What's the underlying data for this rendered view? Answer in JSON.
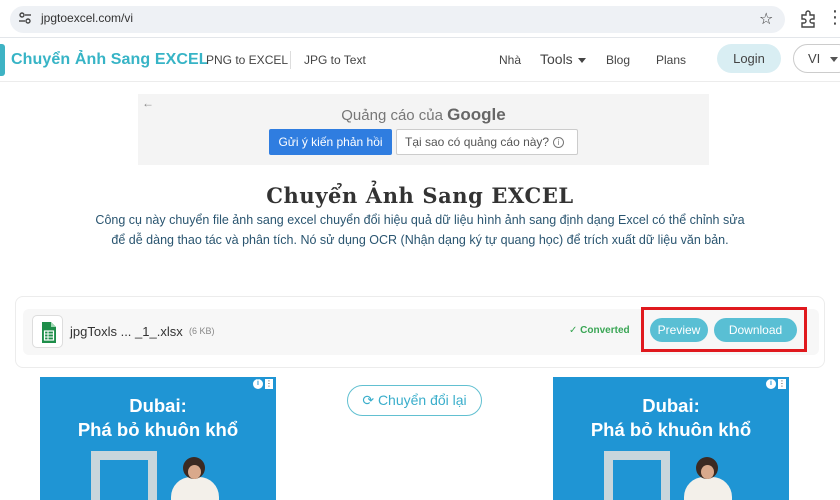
{
  "browser": {
    "url": "jpgtoexcel.com/vi"
  },
  "nav": {
    "brand": "Chuyển Ảnh Sang EXCEL",
    "links": [
      "PNG to EXCEL",
      "JPG to Text"
    ],
    "right_links": [
      "Nhà",
      "Blog",
      "Plans"
    ],
    "tools_label": "Tools",
    "login_label": "Login",
    "language": "VI"
  },
  "ad": {
    "caption_prefix": "Quảng cáo của ",
    "caption_brand": "Google",
    "feedback_label": "Gửi ý kiến phản hồi",
    "why_label": "Tại sao có quảng cáo này?"
  },
  "main": {
    "title": "Chuyển Ảnh Sang EXCEL",
    "description": "Công cụ này chuyển file ảnh sang excel chuyển đổi hiệu quả dữ liệu hình ảnh sang định dạng Excel có thể chỉnh sửa để dễ dàng thao tác và phân tích. Nó sử dụng OCR (Nhận dạng ký tự quang học) để trích xuất dữ liệu văn bản."
  },
  "file": {
    "name": "jpgToxls ... _1_.xlsx",
    "size": "(6 KB)",
    "status": "Converted",
    "preview_label": "Preview",
    "download_label": "Download"
  },
  "retry_label": "Chuyển đổi lại",
  "side_ads": {
    "headline_line1": "Dubai:",
    "headline_line2": "Phá bỏ khuôn khổ"
  },
  "colors": {
    "brand": "#37b4c6",
    "accent_button": "#59bfd4",
    "highlight_box": "#e0191e",
    "ad_blue": "#1f95d4",
    "converted_green": "#3aa655"
  }
}
